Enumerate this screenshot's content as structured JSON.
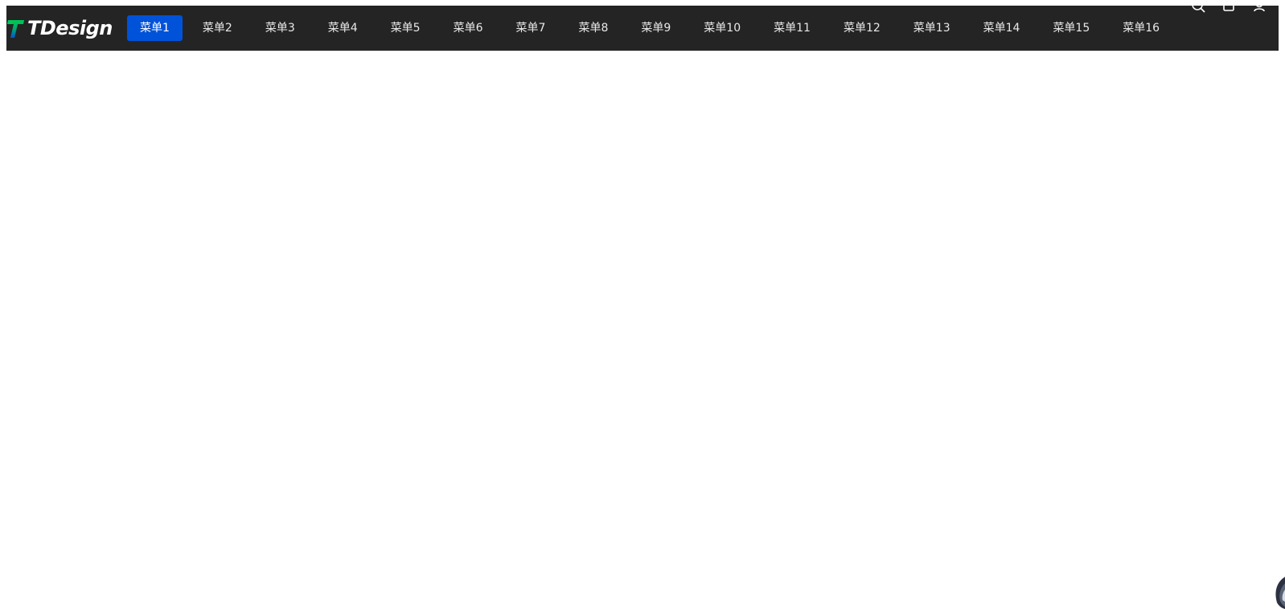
{
  "header": {
    "logo_text": "TDesign",
    "menu": [
      {
        "label": "菜单1",
        "active": true
      },
      {
        "label": "菜单2",
        "active": false
      },
      {
        "label": "菜单3",
        "active": false
      },
      {
        "label": "菜单4",
        "active": false
      },
      {
        "label": "菜单5",
        "active": false
      },
      {
        "label": "菜单6",
        "active": false
      },
      {
        "label": "菜单7",
        "active": false
      },
      {
        "label": "菜单8",
        "active": false
      },
      {
        "label": "菜单9",
        "active": false
      },
      {
        "label": "菜单10",
        "active": false
      },
      {
        "label": "菜单11",
        "active": false
      },
      {
        "label": "菜单12",
        "active": false
      },
      {
        "label": "菜单13",
        "active": false
      },
      {
        "label": "菜单14",
        "active": false
      },
      {
        "label": "菜单15",
        "active": false
      },
      {
        "label": "菜单16",
        "active": false
      }
    ],
    "operations": [
      "search-icon",
      "notification-icon",
      "user-icon"
    ]
  },
  "colors": {
    "header_bg": "#242424",
    "active_bg": "#0052d9",
    "menu_text": "#e8e8e8",
    "logo_green": "#00c853",
    "logo_blue": "#0052d9"
  }
}
